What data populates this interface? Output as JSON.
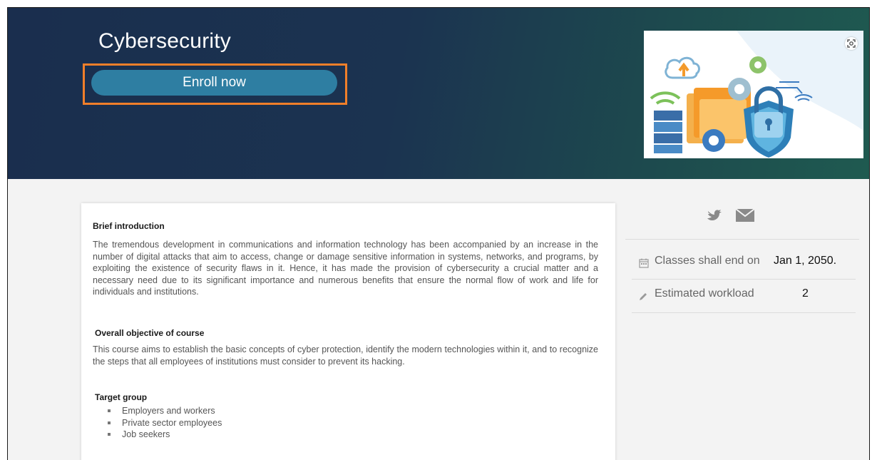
{
  "hero": {
    "title": "Cybersecurity",
    "enroll_label": "Enroll now"
  },
  "intro": {
    "heading": "Brief introduction",
    "text": " The tremendous development in communications and information technology has been accompanied by an increase in the number of digital attacks that aim to access, change or damage sensitive information in systems, networks, and programs, by exploiting the existence of security flaws in it. Hence, it has made the provision of cybersecurity a crucial matter and a necessary need due to its significant importance and numerous benefits that ensure the normal flow of work and life for individuals and institutions."
  },
  "objective": {
    "heading": "Overall objective of course",
    "text": "This course aims to establish the basic concepts of cyber protection, identify the modern technologies within it, and to recognize the steps that all employees of institutions must consider to prevent its hacking."
  },
  "target": {
    "heading": "Target group",
    "items": [
      "Employers and workers",
      "Private sector employees",
      "Job seekers"
    ]
  },
  "sidebar": {
    "share_icons": [
      "twitter-icon",
      "email-icon"
    ],
    "end_label": "Classes shall end on",
    "end_value": "Jan 1, 2050.",
    "workload_label": "Estimated workload",
    "workload_value": "2"
  },
  "colors": {
    "hero_bg": "#1b3350",
    "enroll_button": "#2e7ea2",
    "highlight": "#f07f2a"
  }
}
